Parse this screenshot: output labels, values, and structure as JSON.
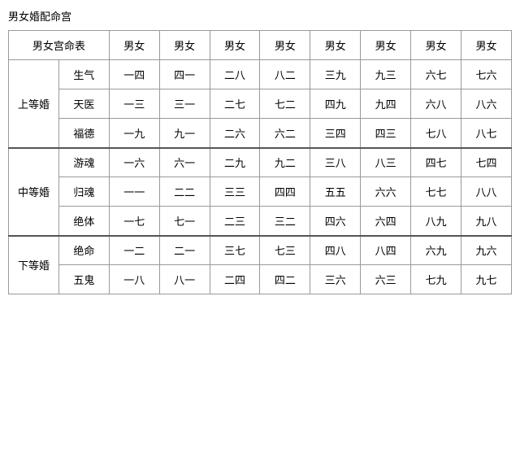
{
  "title": "男女婚配命宫",
  "table": {
    "header": {
      "col0": "男女宫命表",
      "cols": [
        "男女",
        "男女",
        "男女",
        "男女",
        "男女",
        "男女",
        "男女",
        "男女"
      ]
    },
    "groups": [
      {
        "groupLabel": "上等婚",
        "rows": [
          {
            "subLabel": "生气",
            "cells": [
              {
                "text": "一四",
                "red": false
              },
              {
                "text": "四一",
                "red": false
              },
              {
                "text": "二八",
                "red": true
              },
              {
                "text": "八二",
                "red": false
              },
              {
                "text": "三九",
                "red": false
              },
              {
                "text": "九三",
                "red": false
              },
              {
                "text": "六七",
                "red": false
              },
              {
                "text": "七六",
                "red": false
              }
            ]
          },
          {
            "subLabel": "天医",
            "cells": [
              {
                "text": "一三",
                "red": false
              },
              {
                "text": "三一",
                "red": false
              },
              {
                "text": "二七",
                "red": false
              },
              {
                "text": "七二",
                "red": false
              },
              {
                "text": "四九",
                "red": false
              },
              {
                "text": "九四",
                "red": false
              },
              {
                "text": "六八",
                "red": true
              },
              {
                "text": "八六",
                "red": false
              }
            ]
          },
          {
            "subLabel": "福德",
            "cells": [
              {
                "text": "一九",
                "red": false
              },
              {
                "text": "九一",
                "red": false
              },
              {
                "text": "二六",
                "red": false
              },
              {
                "text": "六二",
                "red": false
              },
              {
                "text": "三四",
                "red": false
              },
              {
                "text": "四三",
                "red": false
              },
              {
                "text": "七八",
                "red": true
              },
              {
                "text": "八七",
                "red": false
              }
            ]
          }
        ]
      },
      {
        "groupLabel": "中等婚",
        "rows": [
          {
            "subLabel": "游魂",
            "cells": [
              {
                "text": "一六",
                "red": false
              },
              {
                "text": "六一",
                "red": false
              },
              {
                "text": "二九",
                "red": false
              },
              {
                "text": "九二",
                "red": false
              },
              {
                "text": "三八",
                "red": true
              },
              {
                "text": "八三",
                "red": false
              },
              {
                "text": "四七",
                "red": false
              },
              {
                "text": "七四",
                "red": false
              }
            ]
          },
          {
            "subLabel": "归魂",
            "cells": [
              {
                "text": "一一",
                "red": false
              },
              {
                "text": "二二",
                "red": false
              },
              {
                "text": "三三",
                "red": false
              },
              {
                "text": "四四",
                "red": false
              },
              {
                "text": "五五",
                "red": false
              },
              {
                "text": "六六",
                "red": false
              },
              {
                "text": "七七",
                "red": false
              },
              {
                "text": "八八",
                "red": true
              }
            ]
          },
          {
            "subLabel": "绝体",
            "cells": [
              {
                "text": "一七",
                "red": false
              },
              {
                "text": "七一",
                "red": false
              },
              {
                "text": "二三",
                "red": false
              },
              {
                "text": "三二",
                "red": false
              },
              {
                "text": "四六",
                "red": false
              },
              {
                "text": "六四",
                "red": false
              },
              {
                "text": "八九",
                "red": false
              },
              {
                "text": "九八",
                "red": true
              }
            ]
          }
        ]
      },
      {
        "groupLabel": "下等婚",
        "rows": [
          {
            "subLabel": "绝命",
            "cells": [
              {
                "text": "一二",
                "red": false
              },
              {
                "text": "二一",
                "red": false
              },
              {
                "text": "三七",
                "red": false
              },
              {
                "text": "七三",
                "red": false
              },
              {
                "text": "四八",
                "red": true
              },
              {
                "text": "八四",
                "red": false
              },
              {
                "text": "六九",
                "red": false
              },
              {
                "text": "九六",
                "red": false
              }
            ]
          },
          {
            "subLabel": "五鬼",
            "cells": [
              {
                "text": "一八",
                "red": true
              },
              {
                "text": "八一",
                "red": false
              },
              {
                "text": "二四",
                "red": false
              },
              {
                "text": "四二",
                "red": false
              },
              {
                "text": "三六",
                "red": false
              },
              {
                "text": "六三",
                "red": false
              },
              {
                "text": "七九",
                "red": false
              },
              {
                "text": "九七",
                "red": false
              }
            ]
          }
        ]
      }
    ]
  }
}
